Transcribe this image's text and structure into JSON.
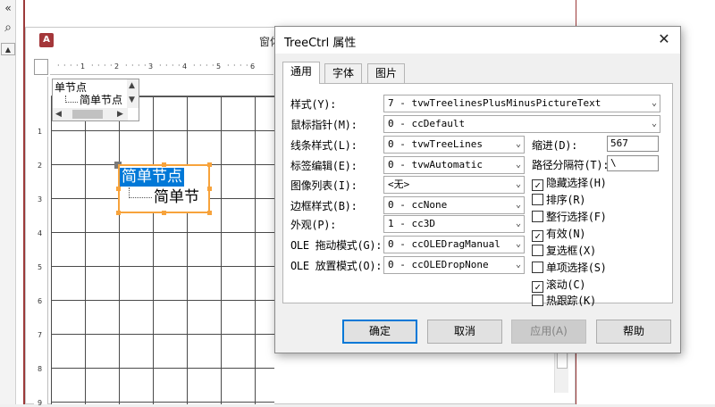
{
  "document": {
    "title_fragment": "窗体",
    "app_icon": "access-icon"
  },
  "form_canvas": {
    "mini_tree": {
      "node1": "单节点",
      "node2": "简单节点"
    },
    "selected_tree": {
      "node1": "简单节点",
      "node2": "简单节"
    },
    "ruler_marks_h": [
      "1",
      "2",
      "3",
      "4",
      "5",
      "6"
    ],
    "ruler_marks_v": [
      "1",
      "2",
      "3",
      "4",
      "5",
      "6",
      "7",
      "8",
      "9"
    ]
  },
  "dialog": {
    "title": "TreeCtrl 属性",
    "tabs": [
      {
        "label": "通用",
        "active": true
      },
      {
        "label": "字体",
        "active": false
      },
      {
        "label": "图片",
        "active": false
      }
    ],
    "fields": {
      "style": {
        "label": "样式(Y):",
        "value": "7 - tvwTreelinesPlusMinusPictureText"
      },
      "mouse_pointer": {
        "label": "鼠标指针(M):",
        "value": "0 - ccDefault"
      },
      "line_style": {
        "label": "线条样式(L):",
        "value": "0 - tvwTreeLines"
      },
      "label_edit": {
        "label": "标签编辑(E):",
        "value": "0 - tvwAutomatic"
      },
      "image_list": {
        "label": "图像列表(I):",
        "value": "<无>"
      },
      "border_style": {
        "label": "边框样式(B):",
        "value": "0 - ccNone"
      },
      "appearance": {
        "label": "外观(P):",
        "value": "1 - cc3D"
      },
      "ole_drag": {
        "label": "OLE 拖动模式(G):",
        "value": "0 - ccOLEDragManual"
      },
      "ole_drop": {
        "label": "OLE 放置模式(O):",
        "value": "0 - ccOLEDropNone"
      },
      "indentation": {
        "label": "缩进(D):",
        "value": "567"
      },
      "path_separator": {
        "label": "路径分隔符(T):",
        "value": "\\"
      }
    },
    "checkboxes": [
      {
        "label": "隐藏选择(H)",
        "checked": true,
        "mark": "✓"
      },
      {
        "label": "排序(R)",
        "checked": false,
        "mark": ""
      },
      {
        "label": "整行选择(F)",
        "checked": false,
        "mark": ""
      },
      {
        "label": "有效(N)",
        "checked": true,
        "mark": "✓"
      },
      {
        "label": "复选框(X)",
        "checked": false,
        "mark": ""
      },
      {
        "label": "单项选择(S)",
        "checked": false,
        "mark": ""
      },
      {
        "label": "滚动(C)",
        "checked": true,
        "mark": "✓"
      },
      {
        "label": "热跟踪(K)",
        "checked": false,
        "mark": ""
      }
    ],
    "buttons": {
      "ok": "确定",
      "cancel": "取消",
      "apply": "应用(A)",
      "help": "帮助"
    },
    "close_glyph": "✕"
  },
  "left_strip": {
    "collapse_glyph": "«",
    "search_glyph": "⌕",
    "up_glyph": "▲"
  }
}
